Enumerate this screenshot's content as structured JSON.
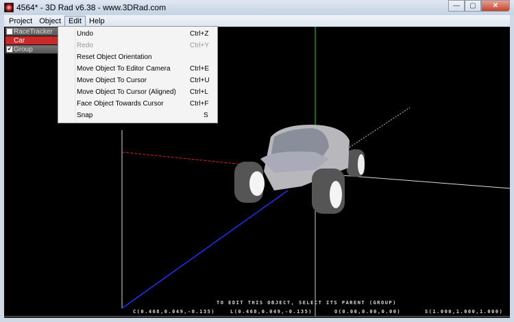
{
  "window": {
    "title": "4564* - 3D Rad v6.38 - www.3DRad.com",
    "min": "—",
    "max": "▢",
    "close": "✕"
  },
  "menubar": [
    "Project",
    "Object",
    "Edit",
    "Help"
  ],
  "tree": [
    {
      "label": "RaceTracker",
      "checked": false
    },
    {
      "label": "Car",
      "selected": true
    },
    {
      "label": "Group",
      "checked": true,
      "mark": "✔"
    }
  ],
  "edit_menu": [
    {
      "label": "Undo",
      "shortcut": "Ctrl+Z"
    },
    {
      "label": "Redo",
      "shortcut": "Ctrl+Y",
      "disabled": true
    },
    {
      "label": "Reset Object Orientation",
      "shortcut": ""
    },
    {
      "label": "Move Object To Editor Camera",
      "shortcut": "Ctrl+E"
    },
    {
      "label": "Move Object To Cursor",
      "shortcut": "Ctrl+U"
    },
    {
      "label": "Move Object To Cursor (Aligned)",
      "shortcut": "Ctrl+L"
    },
    {
      "label": "Face Object Towards Cursor",
      "shortcut": "Ctrl+F"
    },
    {
      "label": "Snap",
      "shortcut": "S"
    }
  ],
  "hud": {
    "message": "TO EDIT THIS OBJECT, SELECT ITS PARENT (GROUP)",
    "c": "C(0.468,0.049,-0.135)",
    "l": "L(0.468,0.049,-0.135)",
    "o": "O(0.00,0.00,0.00)",
    "s": "S(1.000,1.000,1.000)"
  },
  "colors": {
    "axis_x": "#e02020",
    "axis_y": "#20e020",
    "axis_z": "#2030ff",
    "selection": "#c82a2a"
  }
}
